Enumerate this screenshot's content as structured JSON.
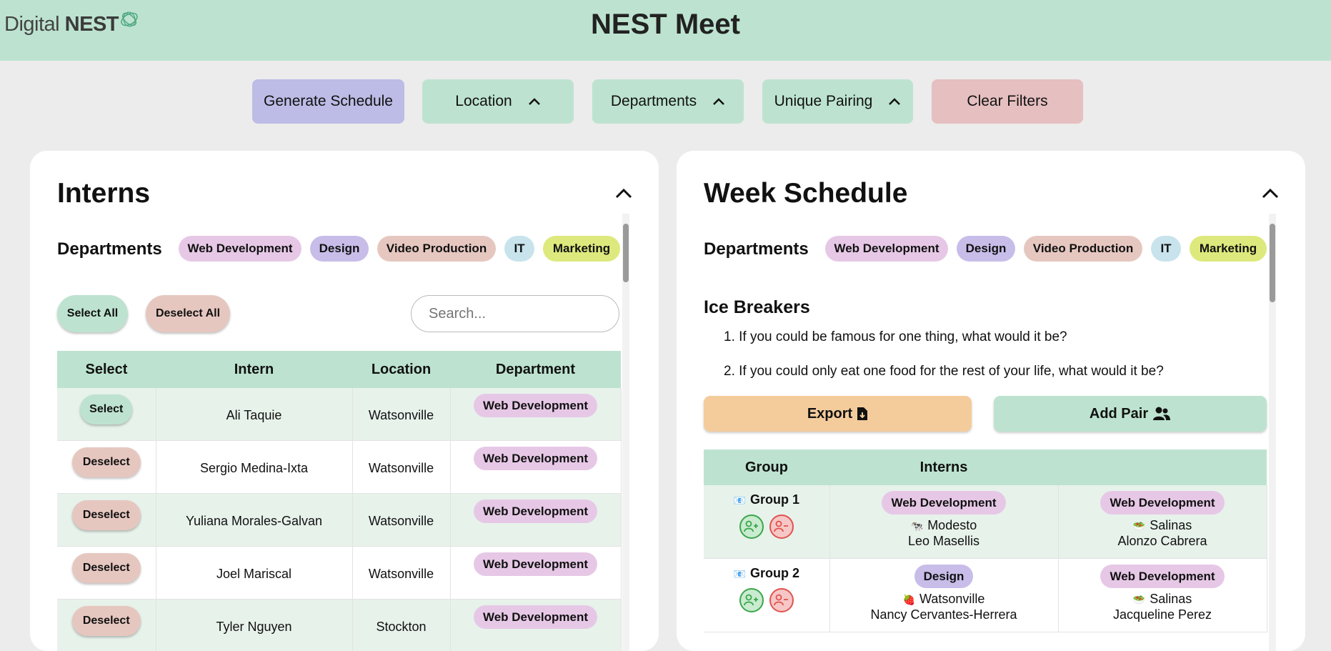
{
  "header": {
    "logo_prefix": "Digital",
    "logo_brand": "NEST",
    "title": "NEST Meet"
  },
  "toolbar": {
    "generate": "Generate Schedule",
    "location": "Location",
    "departments": "Departments",
    "unique_pairing": "Unique Pairing",
    "clear": "Clear Filters"
  },
  "colors": {
    "header": "#bde3d0",
    "web_development": "#e6c8e6",
    "design": "#c8bde9",
    "video_production": "#e6c7c0",
    "it": "#c8e3ec",
    "marketing": "#dde97c",
    "export": "#f4cc9c"
  },
  "departments": [
    "Web Development",
    "Design",
    "Video Production",
    "IT",
    "Marketing"
  ],
  "interns_panel": {
    "title": "Interns",
    "departments_label": "Departments",
    "select_all": "Select All",
    "deselect_all": "Deselect All",
    "search_placeholder": "Search...",
    "columns": [
      "Select",
      "Intern",
      "Location",
      "Department"
    ],
    "rows": [
      {
        "action": "Select",
        "name": "Ali Taquie",
        "location": "Watsonville",
        "department": "Web Development"
      },
      {
        "action": "Deselect",
        "name": "Sergio Medina-Ixta",
        "location": "Watsonville",
        "department": "Web Development"
      },
      {
        "action": "Deselect",
        "name": "Yuliana Morales-Galvan",
        "location": "Watsonville",
        "department": "Web Development"
      },
      {
        "action": "Deselect",
        "name": "Joel Mariscal",
        "location": "Watsonville",
        "department": "Web Development"
      },
      {
        "action": "Deselect",
        "name": "Tyler Nguyen",
        "location": "Stockton",
        "department": "Web Development"
      }
    ]
  },
  "schedule_panel": {
    "title": "Week Schedule",
    "departments_label": "Departments",
    "ice_breakers_title": "Ice Breakers",
    "ice_breakers": [
      "1. If you could be famous for one thing, what would it be?",
      "2. If you could only eat one food for the rest of your life, what would it be?"
    ],
    "export": "Export",
    "add_pair": "Add Pair",
    "columns": [
      "Group",
      "Interns"
    ],
    "groups": [
      {
        "name": "Group 1",
        "icon": "📧",
        "members": [
          {
            "department": "Web Development",
            "emoji": "🐄",
            "location": "Modesto",
            "name": "Leo Masellis"
          },
          {
            "department": "Web Development",
            "emoji": "🥗",
            "location": "Salinas",
            "name": "Alonzo Cabrera"
          }
        ]
      },
      {
        "name": "Group 2",
        "icon": "📧",
        "members": [
          {
            "department": "Design",
            "emoji": "🍓",
            "location": "Watsonville",
            "name": "Nancy Cervantes-Herrera"
          },
          {
            "department": "Web Development",
            "emoji": "🥗",
            "location": "Salinas",
            "name": "Jacqueline Perez"
          }
        ]
      }
    ]
  }
}
